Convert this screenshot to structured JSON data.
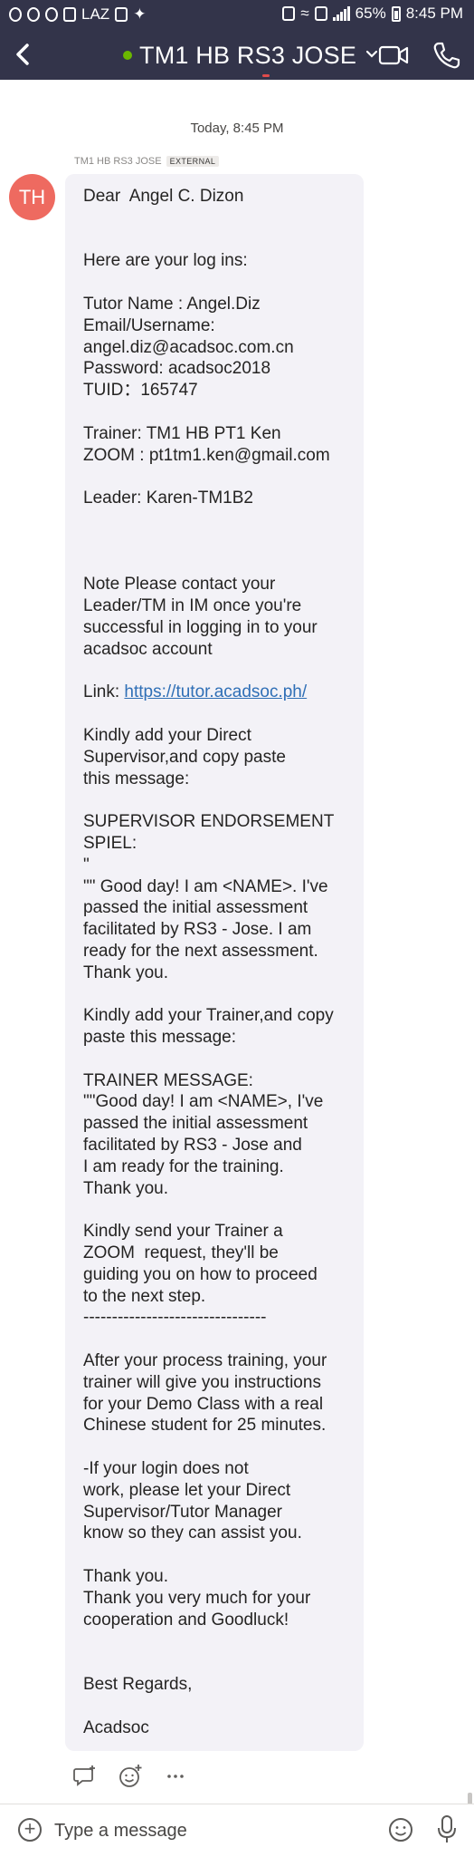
{
  "status_bar": {
    "left_text": "LAZ",
    "battery": "65%",
    "time": "8:45 PM"
  },
  "header": {
    "title": "TM1 HB RS3 JOSE",
    "back_icon": "back-chevron-icon",
    "video_icon": "video-call-icon",
    "call_icon": "phone-call-icon"
  },
  "thread": {
    "date_separator": "Today, 8:45 PM",
    "sender": "TM1 HB RS3 JOSE",
    "sender_tag": "EXTERNAL",
    "avatar_initials": "TH",
    "message_lines": [
      "Dear  Angel C. Dizon",
      "",
      "",
      "Here are your log ins:",
      "",
      "Tutor Name : Angel.Diz",
      "Email/Username:",
      "angel.diz@acadsoc.com.cn",
      "Password: acadsoc2018",
      "TUID：165747",
      "",
      "Trainer: TM1 HB PT1 Ken",
      "ZOOM : pt1tm1.ken@gmail.com",
      "",
      "Leader: Karen-TM1B2",
      "",
      "",
      "",
      "Note Please contact your",
      "Leader/TM in IM once you're",
      "successful in logging in to your",
      "acadsoc account",
      "",
      "Link: https://tutor.acadsoc.ph/",
      "",
      "Kindly add your Direct",
      "Supervisor,and copy paste",
      "this message:",
      "",
      "SUPERVISOR ENDORSEMENT",
      "SPIEL:",
      "\"",
      "\"\" Good day! I am <NAME>. I've",
      "passed the initial assessment",
      "facilitated by RS3 - Jose. I am",
      "ready for the next assessment.",
      "Thank you.",
      "",
      "Kindly add your Trainer,and copy",
      "paste this message:",
      "",
      "TRAINER MESSAGE:",
      "\"\"Good day! I am <NAME>, I've",
      "passed the initial assessment",
      "facilitated by RS3 - Jose and",
      "I am ready for the training.",
      "Thank you.",
      "",
      "Kindly send your Trainer a",
      "ZOOM  request, they'll be",
      "guiding you on how to proceed",
      "to the next step.",
      "--------------------------------",
      "",
      "After your process training, your",
      "trainer will give you instructions",
      "for your Demo Class with a real",
      "Chinese student for 25 minutes.",
      "",
      "-If your login does not",
      "work, please let your Direct",
      "Supervisor/Tutor Manager",
      "know so they can assist you.",
      "",
      "Thank you.",
      "Thank you very much for your",
      "cooperation and Goodluck!",
      "",
      "",
      "Best Regards,",
      "",
      "Acadsoc"
    ],
    "link_prefix": "Link: ",
    "link_text": "https://tutor.acadsoc.ph/",
    "reaction_icons": [
      "reply-icon",
      "add-reaction-icon",
      "more-options-icon"
    ]
  },
  "composer": {
    "placeholder": "Type a message",
    "add_icon": "add-icon",
    "emoji_icon": "emoji-icon",
    "mic_icon": "microphone-icon"
  },
  "colors": {
    "header_bg": "#33344a",
    "bubble_bg": "#f3f2f7",
    "avatar_bg": "#ee6a60",
    "online": "#6bb700",
    "link": "#2f6fb6"
  }
}
